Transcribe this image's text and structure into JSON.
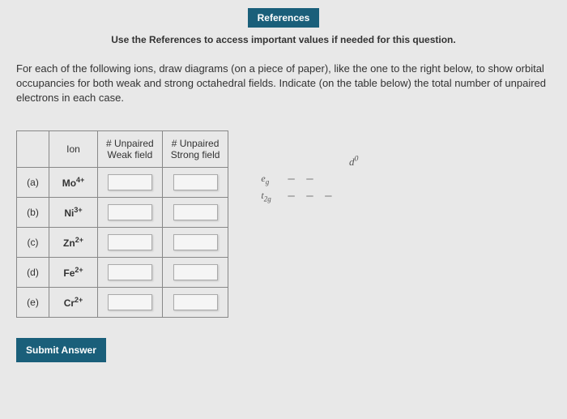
{
  "header": {
    "references_btn": "References",
    "references_note": "Use the References to access important values if needed for this question."
  },
  "question": "For each of the following ions, draw diagrams (on a piece of paper), like the one to the right below, to show orbital occupancies for both weak and strong octahedral fields. Indicate (on the table below) the total number of unpaired electrons in each case.",
  "table": {
    "head": {
      "ion": "Ion",
      "weak_top": "# Unpaired",
      "weak_bottom": "Weak field",
      "strong_top": "# Unpaired",
      "strong_bottom": "Strong field"
    },
    "rows": [
      {
        "label": "(a)",
        "ion_base": "Mo",
        "ion_sup": "4+"
      },
      {
        "label": "(b)",
        "ion_base": "Ni",
        "ion_sup": "3+"
      },
      {
        "label": "(c)",
        "ion_base": "Zn",
        "ion_sup": "2+"
      },
      {
        "label": "(d)",
        "ion_base": "Fe",
        "ion_sup": "2+"
      },
      {
        "label": "(e)",
        "ion_base": "Cr",
        "ion_sup": "2+"
      }
    ]
  },
  "diagram": {
    "d_label_base": "d",
    "d_label_sup": "0",
    "eg_base": "e",
    "eg_sub": "g",
    "eg_dashes": "— —",
    "t2g_base": "t",
    "t2g_sub": "2g",
    "t2g_dashes": "— — —"
  },
  "submit": "Submit Answer"
}
